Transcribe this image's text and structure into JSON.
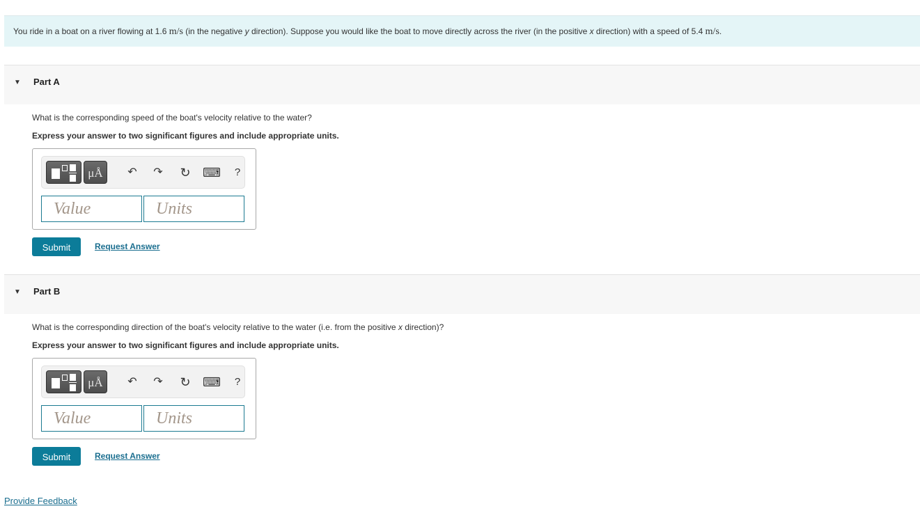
{
  "intro": {
    "prefix": "You ride in a boat on a river flowing at 1.6 ",
    "unit1": "m/s",
    "middle1": " (in the negative ",
    "var_y": "y",
    "middle2": " direction). Suppose you would like the boat to move directly across the river (in the positive ",
    "var_x": "x",
    "middle3": " direction) with a speed of 5.4 ",
    "unit2": "m/s",
    "suffix": "."
  },
  "parts": [
    {
      "title": "Part A",
      "question": "What is the corresponding speed of the boat's velocity relative to the water?",
      "question_var": "",
      "question_suffix": "",
      "instruction": "Express your answer to two significant figures and include appropriate units.",
      "value_placeholder": "Value",
      "units_placeholder": "Units",
      "submit_label": "Submit",
      "request_label": "Request Answer"
    },
    {
      "title": "Part B",
      "question": "What is the corresponding direction of the boat's velocity relative to the water (i.e. from the positive ",
      "question_var": "x",
      "question_suffix": " direction)?",
      "instruction": "Express your answer to two significant figures and include appropriate units.",
      "value_placeholder": "Value",
      "units_placeholder": "Units",
      "submit_label": "Submit",
      "request_label": "Request Answer"
    }
  ],
  "toolbar": {
    "units_label": "μÅ",
    "undo_glyph": "↶",
    "redo_glyph": "↷",
    "reset_glyph": "↻",
    "keyboard_glyph": "⌨",
    "help_glyph": "?",
    "caret_glyph": "▼"
  },
  "footer": {
    "feedback_label": "Provide Feedback"
  },
  "colors": {
    "accent": "#0c7c99",
    "link": "#1a6e8f",
    "intro_bg": "#e4f5f7",
    "header_bg": "#f7f7f7"
  }
}
